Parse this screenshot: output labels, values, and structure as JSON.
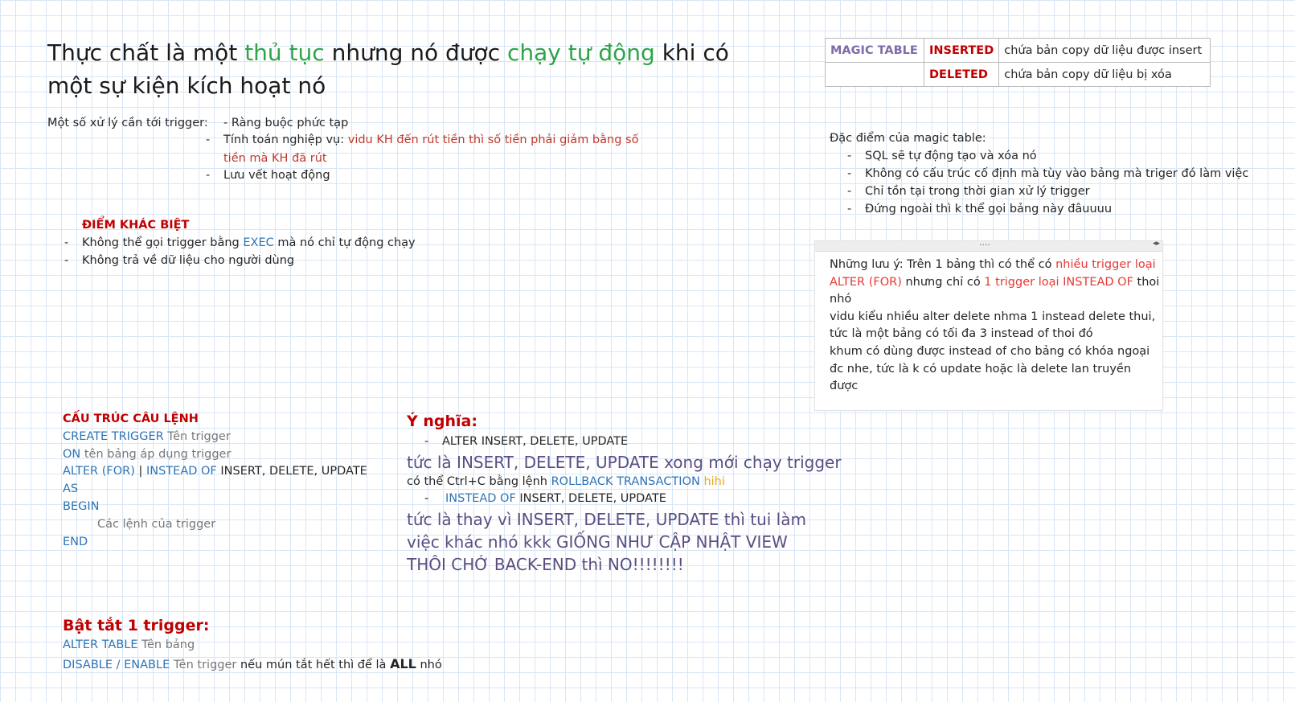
{
  "title": {
    "p1": "Thực chất là một ",
    "p2": "thủ tục",
    "p3": " nhưng nó được ",
    "p4": "chạy tự động",
    "p5": " khi có một sự kiện kích hoạt nó"
  },
  "uses": {
    "label": "Một số xử lý cần tới trigger:",
    "item1": "- Ràng buộc phức tạp",
    "item2_a": "Tính toán nghiệp vụ: ",
    "item2_b": "vidu KH đến rút tiền thì số tiền phải giảm bằng số",
    "item2_c": "tiền mà KH đã rút",
    "item3": "Lưu vết hoạt động"
  },
  "diff": {
    "heading": "ĐIỂM KHÁC BIỆT",
    "i1_a": "Không thể gọi trigger bằng ",
    "i1_b": "EXEC",
    "i1_c": " mà nó chỉ tự động chạy",
    "i2": "Không trả về dữ liệu cho người dùng"
  },
  "magic_table": {
    "name": "MAGIC TABLE",
    "rows": [
      {
        "key": "INSERTED",
        "desc": "chứa bản copy dữ liệu được insert"
      },
      {
        "key": "DELETED",
        "desc": "chứa bản copy dữ liệu bị xóa"
      }
    ]
  },
  "magic_features": {
    "heading": "Đặc điểm của magic table:",
    "items": [
      "SQL sẽ tự động tạo và xóa nó",
      "Không có cấu trúc cố định mà tùy vào bảng mà triger đó làm việc",
      "Chỉ tồn tại trong thời gian xử lý trigger",
      "Đứng ngoài thì k thể gọi bảng này đâuuuu"
    ]
  },
  "note": {
    "handle_dots": "....",
    "handle_arrows": "◂▸",
    "t1": "Những lưu ý: Trên 1 bảng thì có thể có ",
    "t2": "nhiều trigger loại ALTER (FOR)",
    "t3": " nhưng chỉ có ",
    "t4": "1 trigger loại INSTEAD OF",
    "t5": " thoi nhó",
    "l2": "vidu kiểu nhiều alter delete nhma 1 instead delete thui,",
    "l3": "tức là một bảng có tối đa 3 instead of thoi đó",
    "l4": "khum có dùng được instead of cho bảng có khóa ngoại đc nhe, tức là k có update hoặc là delete lan truyền được"
  },
  "structure": {
    "heading": "CẤU TRÚC CÂU LỆNH",
    "l1_a": "CREATE TRIGGER",
    "l1_b": " Tên trigger",
    "l2_a": "ON",
    "l2_b": " tên bảng áp dụng trigger",
    "l3_a": "ALTER (FOR)",
    "l3_b": " | ",
    "l3_c": "INSTEAD OF",
    "l3_d": " INSERT, DELETE, UPDATE",
    "l4": "AS",
    "l5": "BEGIN",
    "l6": "Các lệnh của trigger",
    "l7": "END"
  },
  "meaning": {
    "heading": "Ý nghĩa:",
    "i1": "ALTER  INSERT, DELETE, UPDATE",
    "i1_desc": "tức là  INSERT, DELETE, UPDATE  xong mới chạy trigger",
    "i1_note_a": "có thể Ctrl+C bằng lệnh ",
    "i1_note_b": "ROLLBACK TRANSACTION",
    "i1_note_c": " hihi",
    "i2_a": "INSTEAD OF",
    "i2_b": " INSERT, DELETE, UPDATE",
    "i2_desc": "tức là thay vì  INSERT, DELETE, UPDATE thì tui làm việc khác nhó kkk GIỐNG NHƯ CẬP NHẬT VIEW THÔI CHỚ BACK-END thì NO!!!!!!!!"
  },
  "toggle": {
    "heading": "Bật tắt 1 trigger:",
    "l1_a": "ALTER TABLE",
    "l1_b": " Tên bảng",
    "l2_a": "DISABLE / ENABLE",
    "l2_b": " Tên trigger",
    "l2_c": " nếu mún tắt hết thì để là ",
    "l2_d": "ALL",
    "l2_e": " nhó"
  },
  "bullet": "-"
}
